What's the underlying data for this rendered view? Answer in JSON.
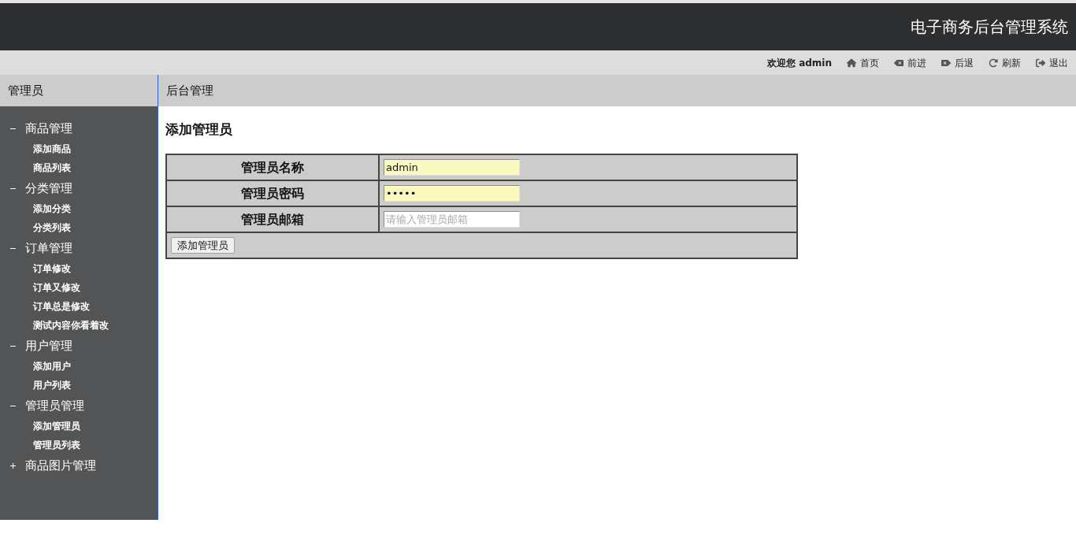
{
  "header": {
    "title": "电子商务后台管理系统"
  },
  "toolbar": {
    "welcome": "欢迎您 admin",
    "links": [
      {
        "kind": "home",
        "label": "首页"
      },
      {
        "kind": "forward",
        "label": "前进"
      },
      {
        "kind": "back",
        "label": "后退"
      },
      {
        "kind": "refresh",
        "label": "刷新"
      },
      {
        "kind": "logout",
        "label": "退出"
      }
    ]
  },
  "sidebar": {
    "title": "管理员",
    "groups": [
      {
        "label": "商品管理",
        "expanded": true,
        "children": [
          {
            "label": "添加商品"
          },
          {
            "label": "商品列表"
          }
        ]
      },
      {
        "label": "分类管理",
        "expanded": true,
        "children": [
          {
            "label": "添加分类"
          },
          {
            "label": "分类列表"
          }
        ]
      },
      {
        "label": "订单管理",
        "expanded": true,
        "children": [
          {
            "label": "订单修改"
          },
          {
            "label": "订单又修改"
          },
          {
            "label": "订单总是修改"
          },
          {
            "label": "测试内容你看着改"
          }
        ]
      },
      {
        "label": "用户管理",
        "expanded": true,
        "children": [
          {
            "label": "添加用户"
          },
          {
            "label": "用户列表"
          }
        ]
      },
      {
        "label": "管理员管理",
        "expanded": true,
        "children": [
          {
            "label": "添加管理员"
          },
          {
            "label": "管理员列表"
          }
        ]
      },
      {
        "label": "商品图片管理",
        "expanded": false
      }
    ]
  },
  "main": {
    "breadcrumb": "后台管理",
    "heading": "添加管理员",
    "form": {
      "fields": [
        {
          "label": "管理员名称",
          "value": "admin",
          "autofilled": true
        },
        {
          "label": "管理员密码",
          "value": "•••••",
          "autofilled": true
        },
        {
          "label": "管理员邮箱",
          "placeholder": "请输入管理员邮箱",
          "autofilled": false
        }
      ],
      "submit": "添加管理员"
    }
  }
}
